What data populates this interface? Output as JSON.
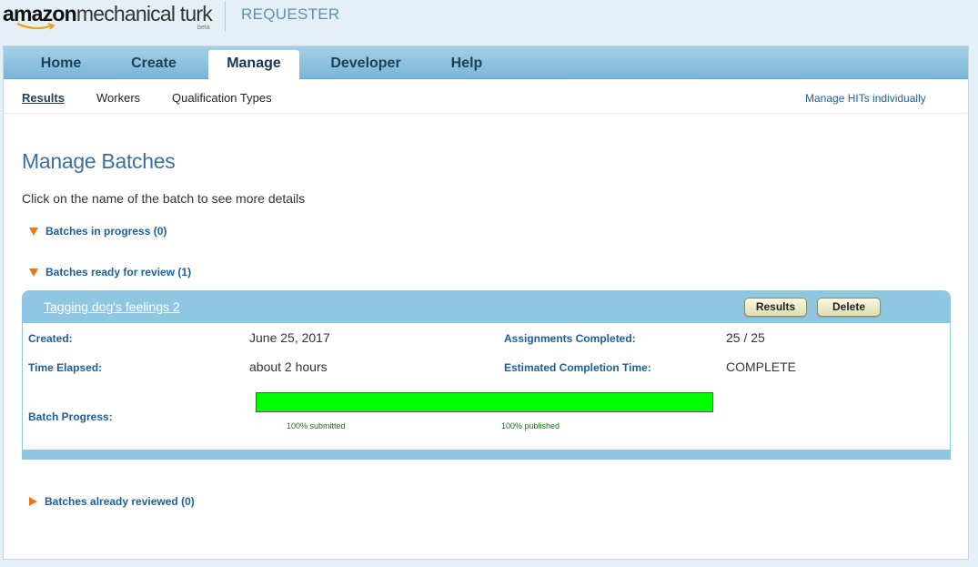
{
  "header": {
    "logo_amazon": "amazon",
    "logo_mechanical_turk": "mechanical turk",
    "logo_beta": "beta",
    "section": "REQUESTER"
  },
  "tabs": [
    {
      "label": "Home",
      "active": false
    },
    {
      "label": "Create",
      "active": false
    },
    {
      "label": "Manage",
      "active": true
    },
    {
      "label": "Developer",
      "active": false
    },
    {
      "label": "Help",
      "active": false
    }
  ],
  "subnav": {
    "items": [
      "Results",
      "Workers",
      "Qualification Types"
    ],
    "active": "Results",
    "right_link": "Manage HITs individually"
  },
  "page": {
    "title": "Manage Batches",
    "description": "Click on the name of the batch to see more details"
  },
  "sections": {
    "in_progress": "Batches in progress (0)",
    "ready_for_review": "Batches ready for review (1)",
    "already_reviewed": "Batches already reviewed (0)"
  },
  "batch": {
    "name": "Tagging dog's feelings 2",
    "results_button": "Results",
    "delete_button": "Delete",
    "created_label": "Created:",
    "created_value": "June 25, 2017",
    "elapsed_label": "Time Elapsed:",
    "elapsed_value": "about 2 hours",
    "assignments_label": "Assignments Completed:",
    "assignments_value": "25 / 25",
    "eta_label": "Estimated Completion Time:",
    "eta_value": "COMPLETE",
    "progress_label": "Batch Progress:",
    "progress_fraction": 1.0,
    "submitted_text": "100% submitted",
    "published_text": "100% published"
  },
  "colors": {
    "tab_bar": "#8fc6e2",
    "link_blue": "#1c5f96",
    "accent_orange": "#e8781e",
    "progress_green": "#00ff00"
  }
}
